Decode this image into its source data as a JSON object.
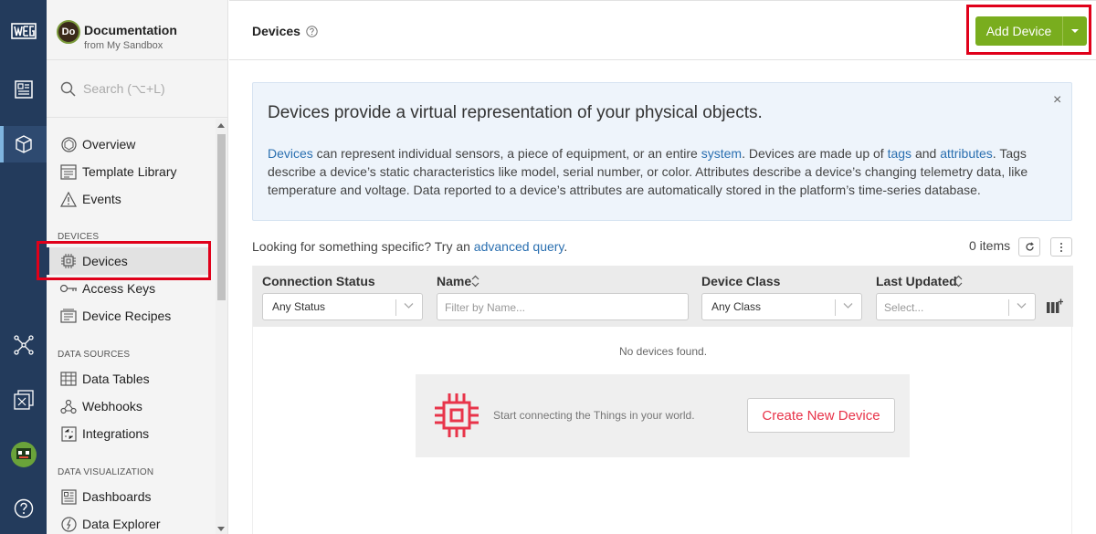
{
  "app": {
    "avatar_initials": "Do",
    "name": "Documentation",
    "subtitle": "from My Sandbox"
  },
  "search": {
    "placeholder": "Search (⌥+L)"
  },
  "nav": {
    "items_top": [
      {
        "label": "Overview",
        "icon": "overview-icon"
      },
      {
        "label": "Template Library",
        "icon": "template-library-icon"
      },
      {
        "label": "Events",
        "icon": "warning-icon"
      }
    ],
    "sections": [
      {
        "label": "DEVICES",
        "items": [
          {
            "label": "Devices",
            "icon": "chip-icon",
            "active": true
          },
          {
            "label": "Access Keys",
            "icon": "key-icon"
          },
          {
            "label": "Device Recipes",
            "icon": "recipe-icon"
          }
        ]
      },
      {
        "label": "DATA SOURCES",
        "items": [
          {
            "label": "Data Tables",
            "icon": "table-icon"
          },
          {
            "label": "Webhooks",
            "icon": "webhook-icon"
          },
          {
            "label": "Integrations",
            "icon": "integrations-icon"
          }
        ]
      },
      {
        "label": "DATA VISUALIZATION",
        "items": [
          {
            "label": "Dashboards",
            "icon": "dashboard-icon"
          },
          {
            "label": "Data Explorer",
            "icon": "explorer-icon"
          }
        ]
      }
    ]
  },
  "header": {
    "title": "Devices",
    "add_button": "Add Device"
  },
  "info": {
    "title": "Devices provide a virtual representation of your physical objects.",
    "body_parts": [
      {
        "text": "Devices",
        "link": true
      },
      {
        "text": " can represent individual sensors, a piece of equipment, or an entire ",
        "link": false
      },
      {
        "text": "system",
        "link": true
      },
      {
        "text": ". Devices are made up of ",
        "link": false
      },
      {
        "text": "tags",
        "link": true
      },
      {
        "text": " and ",
        "link": false
      },
      {
        "text": "attributes",
        "link": true
      },
      {
        "text": ". Tags describe a device’s static characteristics like model, serial number, or color. Attributes describe a device’s changing telemetry data, like temperature and voltage. Data reported to a device’s attributes are automatically stored in the platform’s time-series database.",
        "link": false
      }
    ],
    "close": "×"
  },
  "query": {
    "prefix": "Looking for something specific? Try an ",
    "link": "advanced query",
    "suffix": "."
  },
  "items_count": "0 items",
  "table": {
    "columns": {
      "status": {
        "label": "Connection Status",
        "value": "Any Status"
      },
      "name": {
        "label": "Name",
        "placeholder": "Filter by Name..."
      },
      "class": {
        "label": "Device Class",
        "value": "Any Class"
      },
      "updated": {
        "label": "Last Updated",
        "placeholder": "Select..."
      }
    },
    "empty_message": "No devices found.",
    "empty_hint": "Start connecting the Things in your world.",
    "create_button": "Create New Device"
  },
  "colors": {
    "rail": "#233b5c",
    "accent_green": "#79ad1e",
    "link": "#2a6fb0",
    "create_red": "#e8344a",
    "highlight": "#e0001a"
  }
}
